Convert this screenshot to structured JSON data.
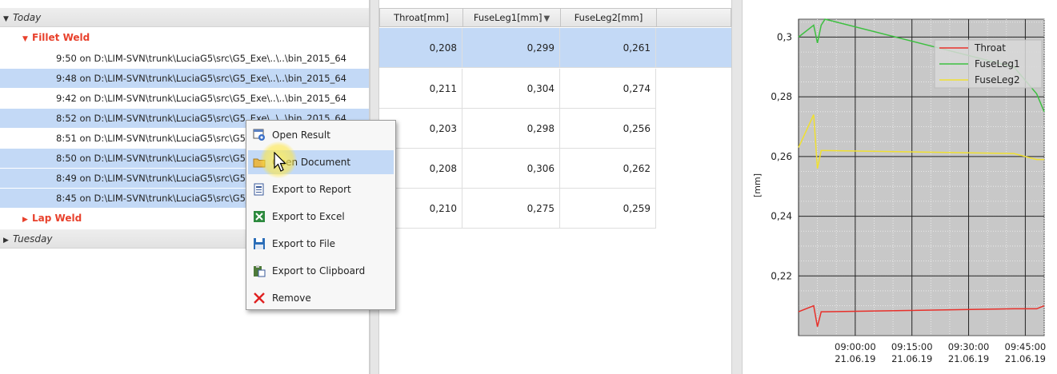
{
  "tree": {
    "groups": [
      {
        "label": "Today"
      },
      {
        "label": "Tuesday"
      }
    ],
    "subgroups": [
      {
        "label": "Fillet Weld"
      },
      {
        "label": "Lap Weld"
      }
    ],
    "rows": [
      {
        "label": "9:50 on D:\\LIM-SVN\\trunk\\LuciaG5\\src\\G5_Exe\\..\\..\\bin_2015_64",
        "selected": false
      },
      {
        "label": "9:48 on D:\\LIM-SVN\\trunk\\LuciaG5\\src\\G5_Exe\\..\\..\\bin_2015_64",
        "selected": true
      },
      {
        "label": "9:42 on D:\\LIM-SVN\\trunk\\LuciaG5\\src\\G5_Exe\\..\\..\\bin_2015_64",
        "selected": false
      },
      {
        "label": "8:52 on D:\\LIM-SVN\\trunk\\LuciaG5\\src\\G5_Exe\\..\\..\\bin_2015_64",
        "selected": true
      },
      {
        "label": "8:51 on D:\\LIM-SVN\\trunk\\LuciaG5\\src\\G5_Exe\\..\\..\\bin_2015_64",
        "selected": false
      },
      {
        "label": "8:50 on D:\\LIM-SVN\\trunk\\LuciaG5\\src\\G5_Exe\\..\\..\\bin_2015_64",
        "selected": true
      },
      {
        "label": "8:49 on D:\\LIM-SVN\\trunk\\LuciaG5\\src\\G5_Exe\\..\\..\\bin_2015_64",
        "selected": true
      },
      {
        "label": "8:45 on D:\\LIM-SVN\\trunk\\LuciaG5\\src\\G5_Exe\\..\\..\\bin_2015_64",
        "selected": true
      }
    ]
  },
  "table": {
    "columns": [
      "Throat[mm]",
      "FuseLeg1[mm]",
      "FuseLeg2[mm]"
    ],
    "sort_indicator": "▼",
    "rows": [
      {
        "cells": [
          "0,208",
          "0,299",
          "0,261"
        ],
        "selected": true
      },
      {
        "cells": [
          "0,211",
          "0,304",
          "0,274"
        ],
        "selected": false
      },
      {
        "cells": [
          "0,203",
          "0,298",
          "0,256"
        ],
        "selected": false
      },
      {
        "cells": [
          "0,208",
          "0,306",
          "0,262"
        ],
        "selected": false
      },
      {
        "cells": [
          "0,210",
          "0,275",
          "0,259"
        ],
        "selected": false
      }
    ]
  },
  "context_menu": {
    "items": [
      {
        "label": "Open Result",
        "icon": "open-result-icon"
      },
      {
        "label": "Open Document",
        "icon": "folder-icon",
        "highlighted": true
      },
      {
        "label": "Export to Report",
        "icon": "report-icon"
      },
      {
        "label": "Export to Excel",
        "icon": "excel-icon"
      },
      {
        "label": "Export to File",
        "icon": "floppy-icon"
      },
      {
        "label": "Export to Clipboard",
        "icon": "clipboard-icon"
      },
      {
        "label": "Remove",
        "icon": "remove-icon"
      }
    ]
  },
  "colors": {
    "selection": "#c3d9f6",
    "subgroup_text": "#e8412c",
    "plot_bg": "#c8c8c8",
    "throat": "#e8302a",
    "fuseleg1": "#3dc040",
    "fuseleg2": "#f0e030"
  },
  "chart_data": {
    "type": "line",
    "title": "",
    "xlabel": "",
    "ylabel": "[mm]",
    "ylim": [
      0.2,
      0.306
    ],
    "yticks": [
      0.22,
      0.24,
      0.26,
      0.28,
      0.3
    ],
    "ytick_labels": [
      "0,22",
      "0,24",
      "0,26",
      "0,28",
      "0,3"
    ],
    "xticks": [
      "08:45",
      "09:00",
      "09:15",
      "09:30",
      "09:45"
    ],
    "xtick_labels": [
      {
        "time": "09:00:00",
        "date": "21.06.19"
      },
      {
        "time": "09:15:00",
        "date": "21.06.19"
      },
      {
        "time": "09:30:00",
        "date": "21.06.19"
      },
      {
        "time": "09:45:00",
        "date": "21.06.19"
      }
    ],
    "xlim": [
      "08:45",
      "09:50"
    ],
    "grid": true,
    "legend": "top-right",
    "x": [
      "08:45",
      "08:49",
      "08:50",
      "08:51",
      "08:52",
      "09:42",
      "09:48",
      "09:50"
    ],
    "series": [
      {
        "name": "Throat",
        "values": [
          0.208,
          0.21,
          0.203,
          0.208,
          0.208,
          0.209,
          0.209,
          0.21
        ]
      },
      {
        "name": "FuseLeg1",
        "values": [
          0.3,
          0.304,
          0.298,
          0.304,
          0.306,
          0.29,
          0.281,
          0.275
        ]
      },
      {
        "name": "FuseLeg2",
        "values": [
          0.263,
          0.274,
          0.256,
          0.262,
          0.262,
          0.261,
          0.259,
          0.259
        ]
      }
    ]
  }
}
